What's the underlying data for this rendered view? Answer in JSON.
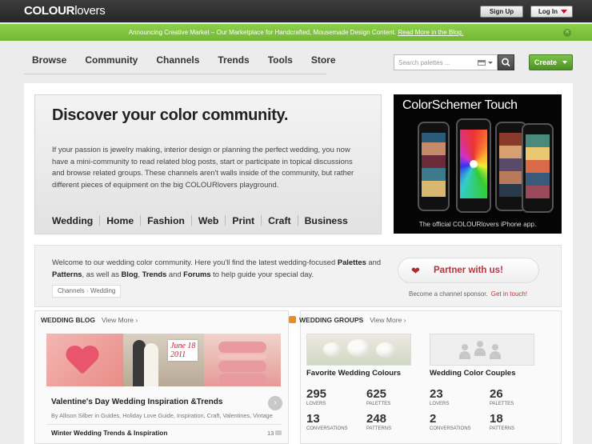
{
  "header": {
    "logo_bold": "COLOUR",
    "logo_light": "lovers",
    "signup": "Sign Up",
    "login": "Log In"
  },
  "announcement": {
    "text": "Announcing Creative Market – Our Marketplace for Handcrafted, Mousemade Design Content.",
    "link": "Read More in the Blog."
  },
  "nav": [
    "Browse",
    "Community",
    "Channels",
    "Trends",
    "Tools",
    "Store"
  ],
  "search": {
    "placeholder": "Search palettes ..."
  },
  "create": "Create",
  "hero": {
    "title": "Discover your color community.",
    "body": "If your passion is jewelry making, interior design or planning the perfect wedding, you now have a mini-community to read related blog posts, start or participate in topical discussions and browse related groups. These channels aren't walls inside of the community, but rather different pieces of equipment on the big COLOURlovers playground.",
    "channels": [
      "Wedding",
      "Home",
      "Fashion",
      "Web",
      "Print",
      "Craft",
      "Business"
    ]
  },
  "ad": {
    "title": "ColorSchemer Touch",
    "caption": "The official COLOURlovers iPhone app."
  },
  "welcome": {
    "t1": "Welcome to our wedding color community. Here you'll find the latest wedding-focused ",
    "palettes": "Palettes",
    "t2": " and ",
    "patterns": "Patterns",
    "t3": ", as well as ",
    "blog": "Blog",
    "t4": ", ",
    "trends": "Trends",
    "t5": " and ",
    "forums": "Forums",
    "t6": " to help guide your special day.",
    "crumb1": "Channels",
    "crumb2": "Wedding",
    "partner": "Partner with us!",
    "sponsor": "Become a channel sponsor.",
    "sponsor_link": "Get in touch!"
  },
  "blog": {
    "header": "WEDDING BLOG",
    "view_more": "View More ›",
    "date_card": "June 18\n2011",
    "post1_title": "Valentine's Day Wedding Inspiration &Trends",
    "post1_meta": "By Allison Silber in Guides, Holiday Love Guide, Inspiration, Craft, Valentines, Vintage",
    "post2_title": "Winter Wedding Trends & Inspiration",
    "post2_count": "13"
  },
  "groups": {
    "header": "WEDDING GROUPS",
    "view_more": "View More ›",
    "items": [
      {
        "name": "Favorite Wedding Colours",
        "lovers": "295",
        "palettes": "625",
        "conversations": "13",
        "patterns": "248"
      },
      {
        "name": "Wedding Color Couples",
        "lovers": "23",
        "palettes": "26",
        "conversations": "2",
        "patterns": "18"
      }
    ],
    "labels": {
      "lovers": "LOVERS",
      "palettes": "PALETTES",
      "conversations": "CONVERSATIONS",
      "patterns": "PATTERNS"
    }
  },
  "colors": {
    "announce_green": "#7fc23f",
    "create_green": "#5fa52f",
    "accent_red": "#c0303a"
  }
}
